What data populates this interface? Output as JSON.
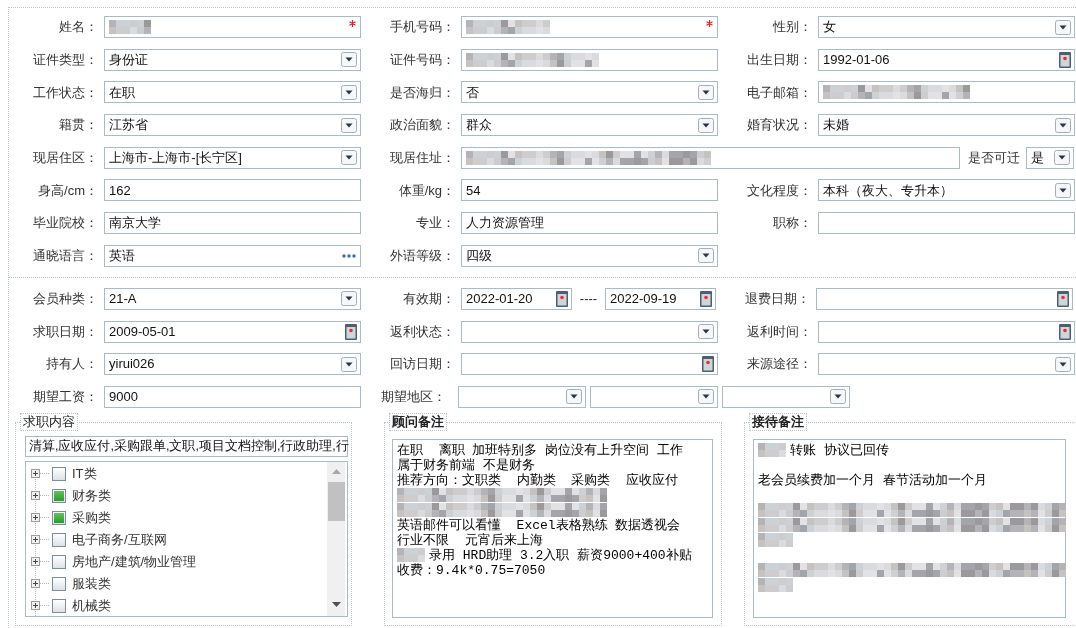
{
  "sections": [
    {
      "rows": [
        [
          {
            "label": "姓名：",
            "kind": "text",
            "redacted": true,
            "required": true
          },
          {
            "label": "手机号码：",
            "kind": "text",
            "redacted": true,
            "required": true
          },
          {
            "label": "性别：",
            "kind": "select",
            "value": "女"
          }
        ],
        [
          {
            "label": "证件类型：",
            "kind": "select",
            "value": "身份证"
          },
          {
            "label": "证件号码：",
            "kind": "text",
            "redacted": true
          },
          {
            "label": "出生日期：",
            "kind": "date",
            "value": "1992-01-06"
          }
        ],
        [
          {
            "label": "工作状态：",
            "kind": "select",
            "value": "在职"
          },
          {
            "label": "是否海归：",
            "kind": "select",
            "value": "否"
          },
          {
            "label": "电子邮箱：",
            "kind": "text",
            "redacted": true
          }
        ],
        [
          {
            "label": "籍贯：",
            "kind": "select",
            "value": "江苏省"
          },
          {
            "label": "政治面貌：",
            "kind": "select",
            "value": "群众"
          },
          {
            "label": "婚育状况：",
            "kind": "select",
            "value": "未婚"
          }
        ],
        [
          {
            "label": "现居住区：",
            "kind": "select",
            "value": "上海市-上海市-[长宁区]"
          },
          {
            "label": "现居住址：",
            "kind": "address",
            "redacted": true
          },
          {
            "label": "是否可迁",
            "kind": "compact_select",
            "value": "是"
          }
        ],
        [
          {
            "label": "身高/cm：",
            "kind": "text",
            "value": "162"
          },
          {
            "label": "体重/kg：",
            "kind": "text",
            "value": "54"
          },
          {
            "label": "文化程度：",
            "kind": "select",
            "value": "本科（夜大、专升本）"
          }
        ],
        [
          {
            "label": "毕业院校：",
            "kind": "text",
            "value": "南京大学"
          },
          {
            "label": "专业：",
            "kind": "text",
            "value": "人力资源管理"
          },
          {
            "label": "职称：",
            "kind": "text"
          }
        ],
        [
          {
            "label": "通晓语言：",
            "kind": "lookup",
            "value": "英语"
          },
          {
            "label": "外语等级：",
            "kind": "select",
            "value": "四级"
          }
        ]
      ]
    },
    {
      "rows": [
        [
          {
            "label": "会员种类：",
            "kind": "select",
            "value": "21-A"
          },
          {
            "label": "有效期：",
            "kind": "date_range",
            "from": "2022-01-20",
            "separator": "----",
            "to": "2022-09-19"
          },
          {
            "label": "退费日期：",
            "kind": "date"
          }
        ],
        [
          {
            "label": "求职日期：",
            "kind": "date",
            "value": "2009-05-01"
          },
          {
            "label": "返利状态：",
            "kind": "select"
          },
          {
            "label": "返利时间：",
            "kind": "date"
          }
        ],
        [
          {
            "label": "持有人：",
            "kind": "select",
            "value": "yirui026"
          },
          {
            "label": "回访日期：",
            "kind": "date"
          },
          {
            "label": "来源途径：",
            "kind": "select"
          }
        ],
        [
          {
            "label": "期望工资：",
            "kind": "text",
            "value": "9000"
          },
          {
            "label": "期望地区：",
            "kind": "multi_select",
            "parts": [
              {
                "kind": "select"
              },
              {
                "kind": "select"
              },
              {
                "kind": "select"
              }
            ]
          }
        ]
      ]
    }
  ],
  "panels": [
    {
      "title": "求职内容",
      "kind": "tree",
      "bold": false,
      "summary": "清算,应收应付,采购跟单,文职,项目文档控制,行政助理,行",
      "items": [
        {
          "label": "IT类",
          "checked": false,
          "expanded": false
        },
        {
          "label": "财务类",
          "checked": true,
          "expanded": false
        },
        {
          "label": "采购类",
          "checked": true,
          "expanded": false
        },
        {
          "label": "电子商务/互联网",
          "checked": false,
          "expanded": false
        },
        {
          "label": "房地产/建筑/物业管理",
          "checked": false,
          "expanded": false
        },
        {
          "label": "服装类",
          "checked": false,
          "expanded": false
        },
        {
          "label": "机械类",
          "checked": false,
          "expanded": false
        }
      ]
    },
    {
      "title": "顾问备注",
      "kind": "notes",
      "bold": true,
      "lines": [
        {
          "kind": "text",
          "text": "在职  离职 加班特别多 岗位没有上升空间 工作"
        },
        {
          "kind": "text",
          "text": "属于财务前端 不是财务"
        },
        {
          "kind": "text",
          "text": "推荐方向：文职类  内勤类  采购类  应收应付"
        },
        {
          "kind": "redacted_medium"
        },
        {
          "kind": "redacted_medium"
        },
        {
          "kind": "text",
          "text": "英语邮件可以看懂  Excel表格熟练 数据透视会"
        },
        {
          "kind": "text",
          "text": "行业不限  元宵后来上海"
        },
        {
          "kind": "text",
          "redacted_prefix": true,
          "text": "录用 HRD助理 3.2入职 薪资9000+400补贴"
        },
        {
          "kind": "text",
          "text": "收费：9.4k*0.75=7050"
        }
      ]
    },
    {
      "title": "接待备注",
      "kind": "notes",
      "bold": true,
      "lines": [
        {
          "kind": "text",
          "redacted_prefix": true,
          "text": "转账 协议已回传"
        },
        {
          "kind": "blank"
        },
        {
          "kind": "text",
          "text": "老会员续费加一个月 春节活动加一个月"
        },
        {
          "kind": "blank"
        },
        {
          "kind": "redacted_long"
        },
        {
          "kind": "redacted_long"
        },
        {
          "kind": "redacted_short"
        },
        {
          "kind": "blank"
        },
        {
          "kind": "redacted_long"
        },
        {
          "kind": "redacted_short"
        }
      ]
    }
  ]
}
